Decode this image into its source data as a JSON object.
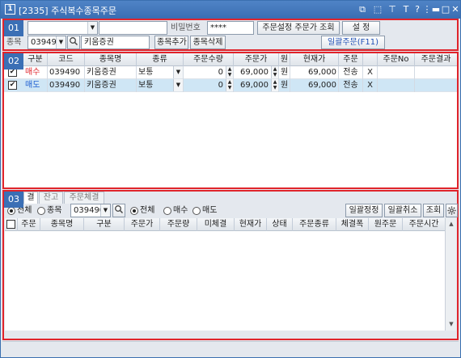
{
  "window": {
    "title": "[2335] 주식복수종목주문",
    "icon_label": "1",
    "title_buttons": [
      "restore-icon",
      "copy-window-icon",
      "pin-icon",
      "font-size-icon",
      "help-icon",
      "minimize-icon",
      "maximize-icon",
      "close-icon"
    ],
    "title_button_glyphs": [
      "⧉",
      "⬚",
      "⊤",
      "T",
      "?",
      "⋮",
      "▬",
      "□",
      "✕"
    ]
  },
  "section1": {
    "badge": "01",
    "account_value": "",
    "account_name": "",
    "password_label": "비밀번호",
    "password_value": "****",
    "btn_order_price_setting": "주문설정 주문가 조회",
    "btn_settings": "설 정",
    "stock_label": "종목",
    "stock_code": "039490",
    "stock_name": "키움증권",
    "btn_add_stock": "종목추가",
    "btn_delete_stock": "종목삭제",
    "btn_bulk_order": "일괄주문(F11)"
  },
  "section2": {
    "badge": "02",
    "columns": [
      "구분",
      "코드",
      "종목명",
      "종류",
      "주문수량",
      "주문가",
      "원",
      "현재가",
      "주문",
      "주문No",
      "주문결과"
    ],
    "rows": [
      {
        "checked": true,
        "side": "매수",
        "side_color": "#e0242b",
        "code": "039490",
        "name": "키움증권",
        "type": "보통",
        "qty": "0",
        "price": "69,000",
        "unit": "원",
        "current": "69,000",
        "action": "전송",
        "x": "X",
        "order_no": "",
        "result": ""
      },
      {
        "checked": true,
        "side": "매도",
        "side_color": "#1f5fd1",
        "code": "039490",
        "name": "키움증권",
        "type": "보통",
        "qty": "0",
        "price": "69,000",
        "unit": "원",
        "current": "69,000",
        "action": "전송",
        "x": "X",
        "order_no": "",
        "result": ""
      }
    ]
  },
  "section3": {
    "badge": "03",
    "tabs": [
      "결",
      "잔고",
      "주문체결"
    ],
    "filter_all": "전체",
    "filter_stock": "종목",
    "stock_code": "039490",
    "side_all": "전체",
    "side_buy": "매수",
    "side_sell": "매도",
    "btn_bulk_modify": "일괄정정",
    "btn_bulk_cancel": "일괄취소",
    "btn_query": "조회",
    "columns": [
      "주문",
      "종목명",
      "구분",
      "주문가",
      "주문량",
      "미체결",
      "현재가",
      "상태",
      "주문종류",
      "체결폭",
      "원주문",
      "주문시간"
    ]
  },
  "colors": {
    "accent": "#3b6fb5",
    "highlight": "#e0242b",
    "selected_row": "#cfe6f5"
  }
}
